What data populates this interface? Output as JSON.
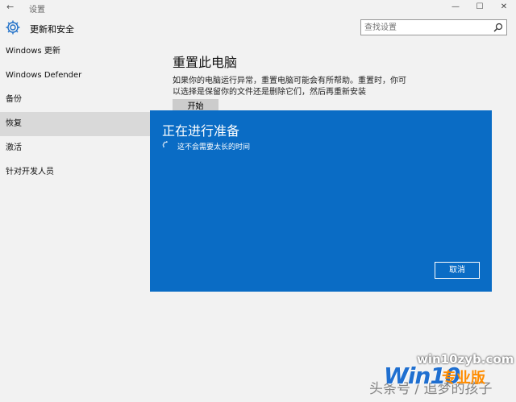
{
  "window": {
    "back_glyph": "←",
    "title": "设置",
    "controls": {
      "minimize": "—",
      "maximize": "☐",
      "close": "✕"
    }
  },
  "header": {
    "title": "更新和安全",
    "icon": "gear-icon"
  },
  "search": {
    "placeholder": "查找设置",
    "icon": "search-icon"
  },
  "sidebar": {
    "items": [
      {
        "label": "Windows 更新",
        "active": false
      },
      {
        "label": "Windows Defender",
        "active": false
      },
      {
        "label": "备份",
        "active": false
      },
      {
        "label": "恢复",
        "active": true
      },
      {
        "label": "激活",
        "active": false
      },
      {
        "label": "针对开发人员",
        "active": false
      }
    ]
  },
  "main": {
    "title": "重置此电脑",
    "description": "如果你的电脑运行异常，重置电脑可能会有所帮助。重置时，你可以选择是保留你的文件还是删除它们，然后再重新安装 Windows。",
    "start_label": "开始"
  },
  "dialog": {
    "title": "正在进行准备",
    "message": "这不会需要太长的时间",
    "cancel_label": "取消",
    "background_color": "#0a6cc5"
  },
  "watermarks": {
    "url": "win10zyb.com",
    "credit": "头条号 / 追梦的孩子",
    "brand": "Win10",
    "brand_cn": "专业版"
  }
}
